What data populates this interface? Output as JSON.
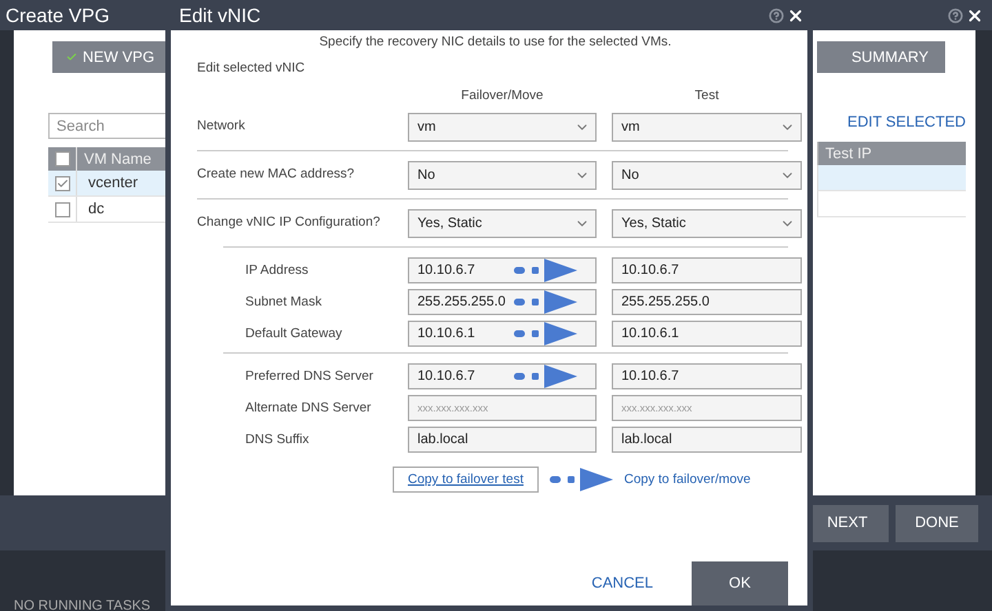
{
  "background_window": {
    "title": "Create VPG",
    "new_button": "NEW VPG",
    "wizard_step": "SUMMARY",
    "search": {
      "placeholder": "Search"
    },
    "edit_selected": "EDIT SELECTED",
    "table": {
      "columns": [
        "VM Name",
        "Test IP"
      ],
      "header_checked": false,
      "rows": [
        {
          "name": "vcenter",
          "selected": true
        },
        {
          "name": "dc",
          "selected": false
        }
      ]
    },
    "buttons": [
      "NEXT",
      "DONE"
    ]
  },
  "status_bar": "NO RUNNING TASKS",
  "dialog": {
    "title": "Edit vNIC",
    "instruction": "Specify the recovery NIC details to use for the selected VMs.",
    "section": "Edit selected vNIC",
    "columns": [
      "Failover/Move",
      "Test"
    ],
    "groups": [
      {
        "kind": "main",
        "rows": [
          {
            "kind": "select",
            "label": "Network",
            "failover": {
              "value": "vm"
            },
            "test": {
              "value": "vm"
            },
            "arrow": false
          }
        ]
      },
      {
        "kind": "main",
        "rows": [
          {
            "kind": "select",
            "label": "Create new MAC address?",
            "failover": {
              "value": "No"
            },
            "test": {
              "value": "No"
            },
            "arrow": false
          }
        ]
      },
      {
        "kind": "main",
        "rows": [
          {
            "kind": "select",
            "label": "Change vNIC IP Configuration?",
            "failover": {
              "value": "Yes, Static"
            },
            "test": {
              "value": "Yes, Static"
            },
            "arrow": false
          }
        ]
      },
      {
        "kind": "ip",
        "rows": [
          {
            "kind": "input",
            "label": "IP Address",
            "failover": {
              "value": "10.10.6.7"
            },
            "test": {
              "value": "10.10.6.7"
            },
            "arrow": true
          },
          {
            "kind": "input",
            "label": "Subnet Mask",
            "failover": {
              "value": "255.255.255.0"
            },
            "test": {
              "value": "255.255.255.0"
            },
            "arrow": true
          },
          {
            "kind": "input",
            "label": "Default Gateway",
            "failover": {
              "value": "10.10.6.1"
            },
            "test": {
              "value": "10.10.6.1"
            },
            "arrow": true
          }
        ]
      },
      {
        "kind": "ip",
        "rows": [
          {
            "kind": "input",
            "label": "Preferred DNS Server",
            "failover": {
              "value": "10.10.6.7"
            },
            "test": {
              "value": "10.10.6.7"
            },
            "arrow": true
          },
          {
            "kind": "input",
            "label": "Alternate DNS Server",
            "failover": {
              "placeholder": "xxx.xxx.xxx.xxx"
            },
            "test": {
              "placeholder": "xxx.xxx.xxx.xxx"
            },
            "arrow": false
          },
          {
            "kind": "input",
            "label": "DNS Suffix",
            "failover": {
              "value": "lab.local"
            },
            "test": {
              "value": "lab.local"
            },
            "arrow": false
          }
        ]
      }
    ],
    "copy_actions": [
      {
        "kind": "button",
        "label": "Copy to failover test"
      },
      {
        "kind": "link",
        "label": "Copy to failover/move"
      }
    ],
    "buttons": [
      {
        "kind": "text",
        "label": "CANCEL"
      },
      {
        "kind": "primary",
        "label": "OK"
      }
    ]
  }
}
